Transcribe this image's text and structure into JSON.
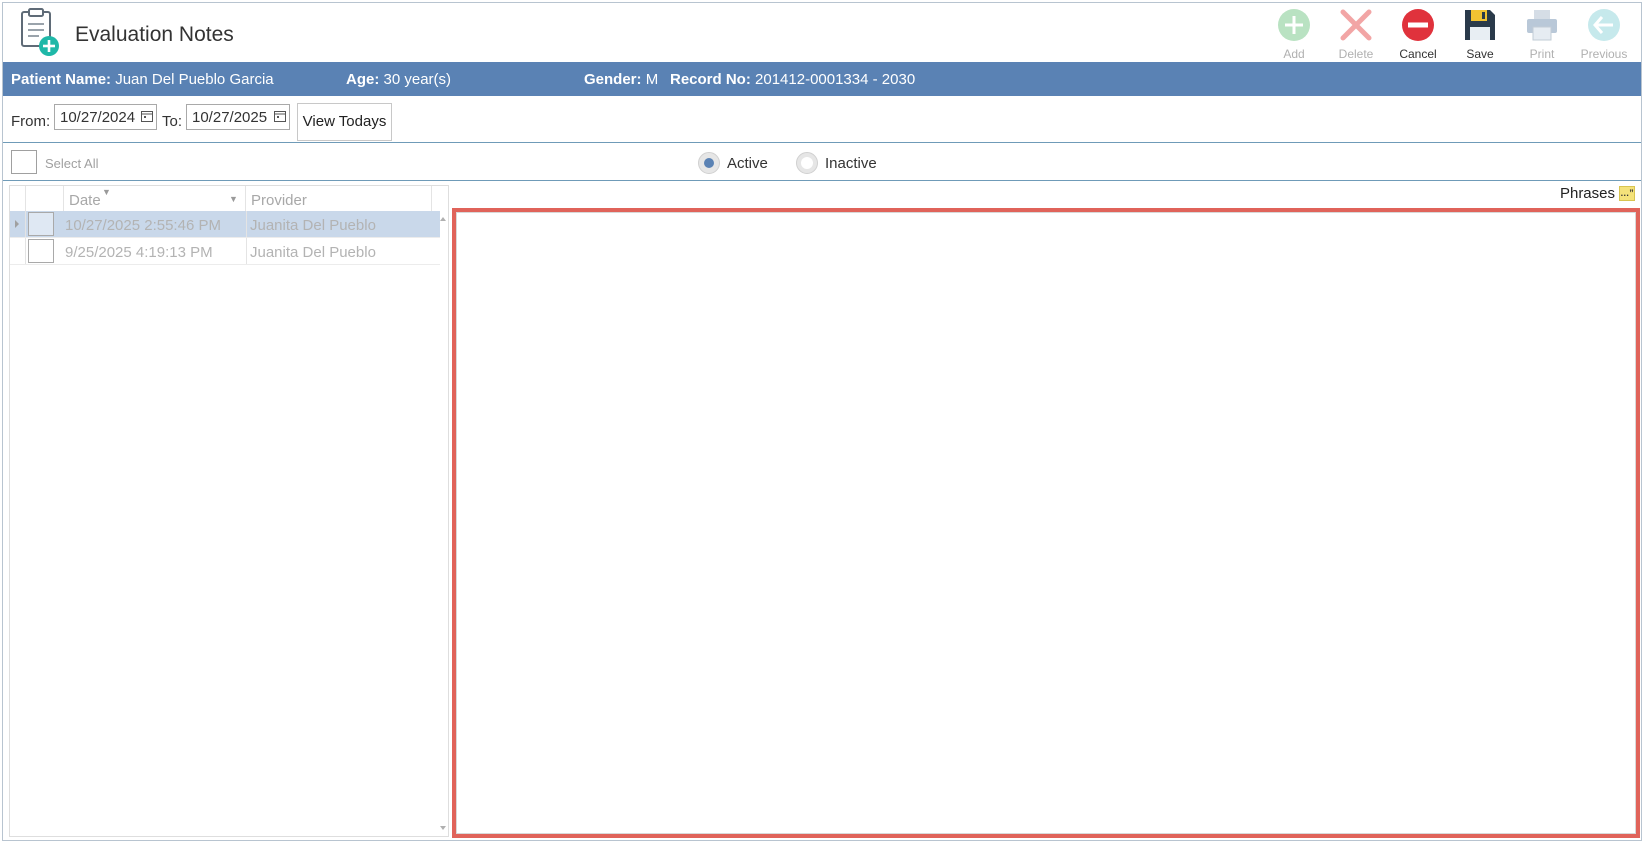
{
  "header": {
    "title": "Evaluation Notes",
    "title_icon": "clipboard-add-icon"
  },
  "toolbar": {
    "add_label": "Add",
    "delete_label": "Delete",
    "cancel_label": "Cancel",
    "save_label": "Save",
    "print_label": "Print",
    "previous_label": "Previous"
  },
  "patient": {
    "name_label": "Patient Name:",
    "name_value": "Juan Del Pueblo Garcia",
    "age_label": "Age:",
    "age_value": "30 year(s)",
    "gender_label": "Gender:",
    "gender_value": "M",
    "record_label": "Record No:",
    "record_value": "201412-0001334 - 2030"
  },
  "filter": {
    "from_label": "From:",
    "from_value": "10/27/2024",
    "to_label": "To:",
    "to_value": "10/27/2025",
    "view_todays_label": "View Todays"
  },
  "selection": {
    "select_all_label": "Select All",
    "active_label": "Active",
    "inactive_label": "Inactive",
    "selected_status": "Active"
  },
  "grid": {
    "columns": [
      "Date",
      "Provider"
    ],
    "rows": [
      {
        "date": "10/27/2025 2:55:46 PM",
        "provider": "Juanita Del Pueblo",
        "selected": true
      },
      {
        "date": "9/25/2025 4:19:13 PM",
        "provider": "Juanita Del Pueblo",
        "selected": false
      }
    ]
  },
  "editor": {
    "phrases_label": "Phrases",
    "phrases_icon": "quote-icon",
    "phrases_icon_glyph": "…”"
  },
  "colors": {
    "patient_bar": "#5a82b4",
    "selected_row": "#c9d8ea",
    "editor_highlight": "#e0635a",
    "add": "#9bd3a6",
    "delete": "#f2a5a5",
    "cancel": "#e0323c",
    "save": "#2a3a4a",
    "previous": "#9fd8de"
  }
}
